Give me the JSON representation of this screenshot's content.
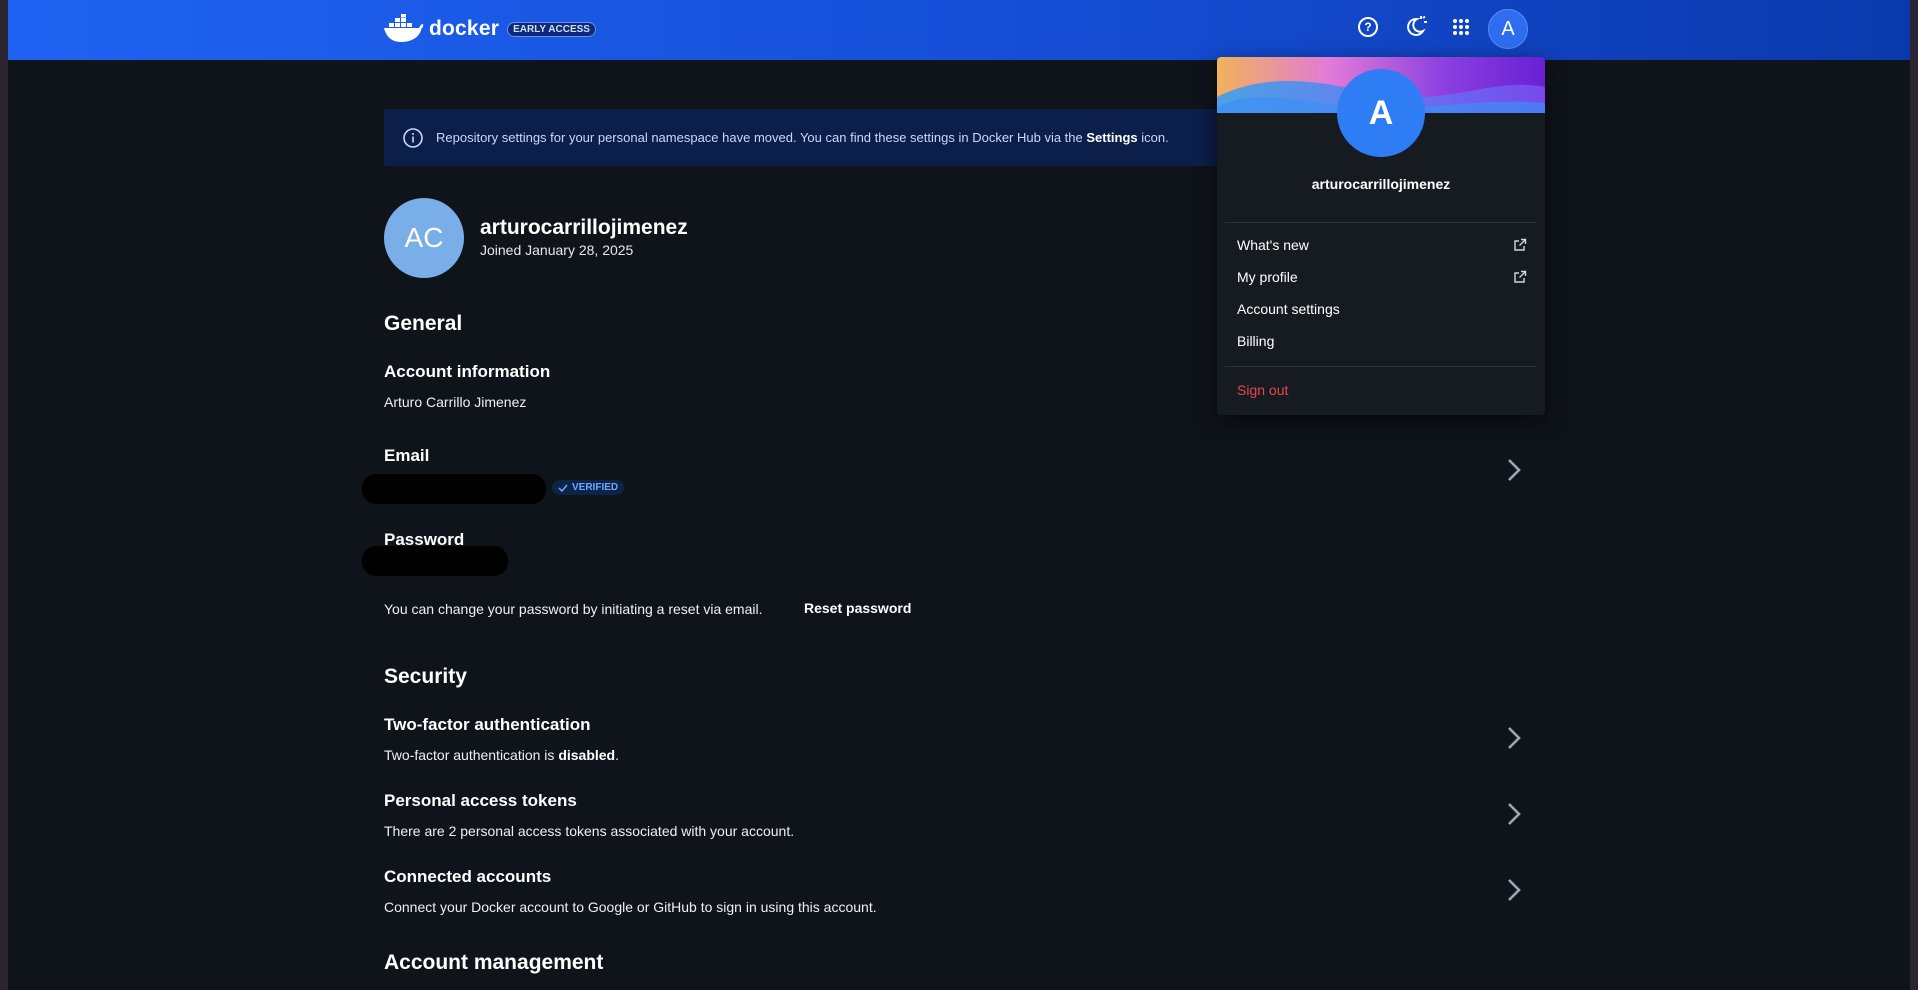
{
  "topbar": {
    "brand": "docker",
    "badge": "EARLY ACCESS",
    "avatar_initial": "A",
    "icons": [
      "help-icon",
      "theme-toggle-icon",
      "apps-grid-icon"
    ]
  },
  "banner": {
    "text_before": "Repository settings for your personal namespace have moved. You can find these settings in Docker Hub via the ",
    "text_bold": "Settings",
    "text_after": " icon."
  },
  "profile": {
    "initials": "AC",
    "username": "arturocarrillojimenez",
    "joined": "Joined January 28, 2025"
  },
  "general": {
    "heading": "General",
    "account_info_title": "Account information",
    "account_info_value": "Arturo Carrillo Jimenez",
    "email_title": "Email",
    "email_badge": "VERIFIED",
    "password_title": "Password",
    "password_hint": "You can change your password by initiating a reset via email.",
    "reset_label": "Reset password"
  },
  "security": {
    "heading": "Security",
    "twofa_title": "Two-factor authentication",
    "twofa_text_before": "Two-factor authentication is ",
    "twofa_status": "disabled",
    "twofa_text_after": ".",
    "tokens_title": "Personal access tokens",
    "tokens_text": "There are 2 personal access tokens associated with your account.",
    "connected_title": "Connected accounts",
    "connected_text": "Connect your Docker account to Google or GitHub to sign in using this account."
  },
  "account_management": {
    "heading": "Account management"
  },
  "menu": {
    "avatar_initial": "A",
    "username": "arturocarrillojimenez",
    "items": [
      {
        "label": "What's new",
        "external": true
      },
      {
        "label": "My profile",
        "external": true
      },
      {
        "label": "Account settings",
        "external": false
      },
      {
        "label": "Billing",
        "external": false
      }
    ],
    "signout": "Sign out"
  },
  "colors": {
    "topbar_start": "#1f63f2",
    "topbar_end": "#0b39ad",
    "background": "#0f141a",
    "accent": "#2f7df5",
    "danger": "#e5484d"
  }
}
